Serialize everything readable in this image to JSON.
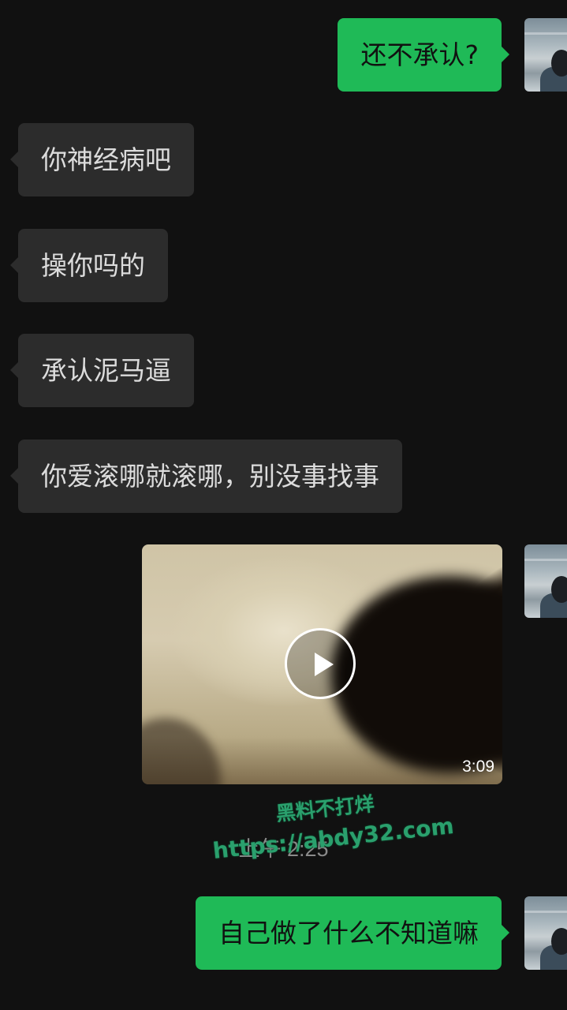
{
  "messages": [
    {
      "side": "out",
      "text": "还不承认?"
    },
    {
      "side": "in",
      "text": "你神经病吧"
    },
    {
      "side": "in",
      "text": "操你吗的"
    },
    {
      "side": "in",
      "text": "承认泥马逼"
    },
    {
      "side": "in",
      "text": "你爱滚哪就滚哪，别没事找事"
    },
    {
      "side": "out",
      "type": "video",
      "duration": "3:09"
    },
    {
      "side": "out",
      "text": "自己做了什么不知道嘛"
    }
  ],
  "timestamp": "上午 2:25",
  "watermark": {
    "line1": "黑料不打烊",
    "line2": "https://abdy32.com"
  },
  "colors": {
    "background": "#111111",
    "incoming_bubble": "#2c2c2c",
    "outgoing_bubble": "#1fba57",
    "watermark": "#2aa06d"
  },
  "icons": {
    "video_play": "play-icon",
    "avatar": "user-avatar"
  }
}
